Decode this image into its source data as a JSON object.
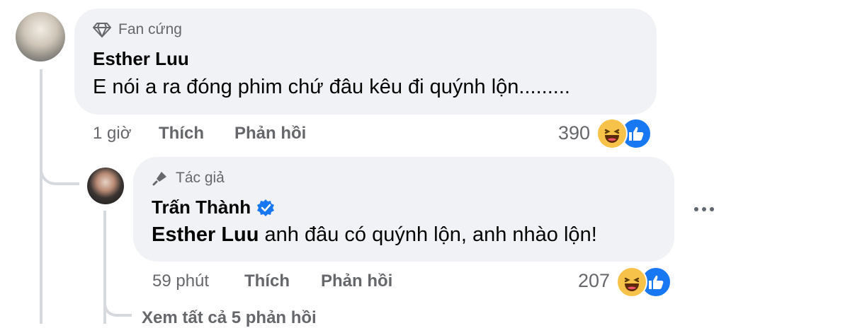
{
  "comment": {
    "badge": "Fan cứng",
    "author": "Esther Luu",
    "text": "E nói a ra đóng phim chứ đâu kêu đi quýnh lộn.........",
    "time": "1 giờ",
    "like_label": "Thích",
    "reply_label": "Phản hồi",
    "reaction_count": "390",
    "reactions": [
      "haha-emoji",
      "like-emoji"
    ]
  },
  "reply": {
    "badge": "Tác giả",
    "author": "Trấn Thành",
    "verified": true,
    "mention": "Esther Luu",
    "text": " anh đâu có quýnh lộn, anh nhào lộn!",
    "time": "59 phút",
    "like_label": "Thích",
    "reply_label": "Phản hồi",
    "reaction_count": "207",
    "reactions": [
      "haha-emoji",
      "like-emoji"
    ]
  },
  "footer": {
    "partial_text": "Xem tất cả 5 phản hồi"
  },
  "colors": {
    "bubble": "#f0f2f5",
    "muted": "#65676b",
    "like_blue": "#1877f2",
    "haha_yellow": "#f7c24a"
  }
}
